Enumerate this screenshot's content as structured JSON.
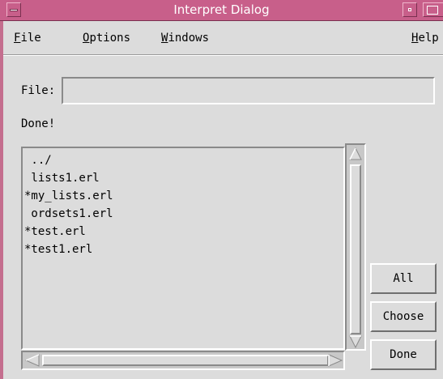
{
  "window": {
    "title": "Interpret Dialog"
  },
  "menubar": {
    "file": {
      "mnemonic": "F",
      "rest": "ile"
    },
    "options": {
      "mnemonic": "O",
      "rest": "ptions"
    },
    "windows": {
      "mnemonic": "W",
      "rest": "indows"
    },
    "help": {
      "mnemonic": "H",
      "rest": "elp"
    }
  },
  "file_field": {
    "label": "File:",
    "value": ""
  },
  "status_text": "Done!",
  "file_list": {
    "items": [
      " ../",
      " lists1.erl",
      "*my_lists.erl",
      " ordsets1.erl",
      "*test.erl",
      "*test1.erl"
    ]
  },
  "buttons": {
    "all": "All",
    "choose": "Choose",
    "done": "Done"
  },
  "colors": {
    "titlebar": "#c85f8a",
    "background": "#dcdcdc"
  }
}
